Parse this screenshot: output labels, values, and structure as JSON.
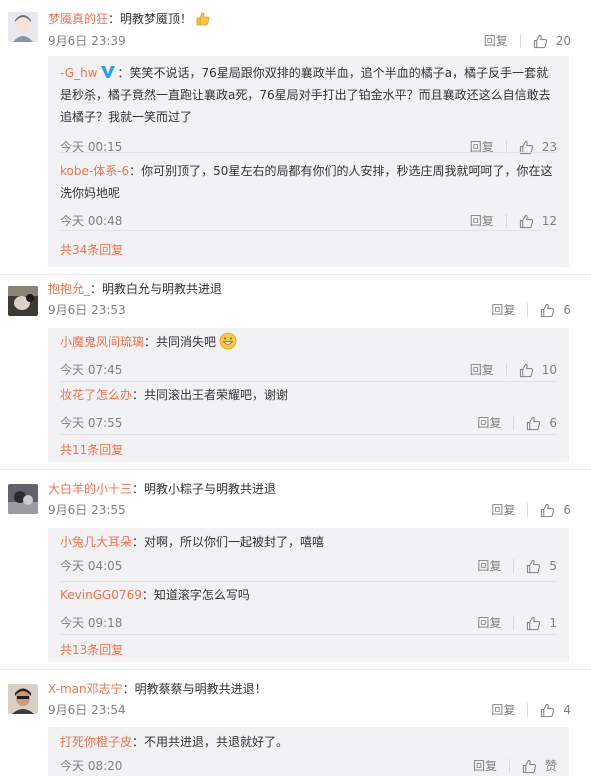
{
  "threads": [
    {
      "user": "梦魇真的狂",
      "text": "：明教梦魇顶！",
      "time": "9月6日 23:39",
      "reply": "回复",
      "likes": "20",
      "subs": [
        {
          "user": "-G_hw",
          "text": "：笑笑不说话，76星局跟你双排的襄政半血，追个半血的橘子a，橘子反手一套就是秒杀，橘子竟然一直跑让襄政a死，76星局对手打出了铂金水平？而且襄政还这么自信敢去追橘子？我就一笑而过了",
          "time": "今天 00:15",
          "reply": "回复",
          "likes": "23"
        },
        {
          "user": "kobe-体系-6",
          "text": "：你可别顶了，50星左右的局都有你们的人安排，秒选庄周我就呵呵了，你在这洗你妈地呢",
          "time": "今天 00:48",
          "reply": "回复",
          "likes": "12"
        }
      ],
      "more": "共34条回复"
    },
    {
      "user": "抱抱允_",
      "text": "：明教白允与明教共进退",
      "time": "9月6日 23:53",
      "reply": "回复",
      "likes": "6",
      "subs": [
        {
          "user": "小魔鬼风间琉璃",
          "text": "：共同消失吧",
          "time": "今天 07:45",
          "reply": "回复",
          "likes": "10"
        },
        {
          "user": "妆花了怎么办",
          "text": "：共同滚出王者荣耀吧，谢谢",
          "time": "今天 07:55",
          "reply": "回复",
          "likes": "6"
        }
      ],
      "more": "共11条回复"
    },
    {
      "user": "大白羊的小十三",
      "text": "：明教小粽子与明教共进退",
      "time": "9月6日 23:55",
      "reply": "回复",
      "likes": "6",
      "subs": [
        {
          "user": "小兔几大耳朵",
          "text": "：对啊，所以你们一起被封了，嘻嘻",
          "time": "今天 04:05",
          "reply": "回复",
          "likes": "5"
        },
        {
          "user": "KevinGG0769",
          "text": "：知道滚字怎么写吗",
          "time": "今天 09:18",
          "reply": "回复",
          "likes": "1"
        }
      ],
      "more": "共13条回复"
    },
    {
      "user": "X-man邓志宁",
      "text": "：明教蔡蔡与明教共进退！",
      "time": "9月6日 23:54",
      "reply": "回复",
      "likes": "4",
      "subs": [
        {
          "user": "打死你橙子皮",
          "text": "：不用共进退，共退就好了。",
          "time": "今天 08:20",
          "reply": "回复",
          "likes": "赞"
        }
      ],
      "more": ""
    }
  ],
  "colors": {
    "username": "#eb7350",
    "text": "#333333",
    "meta": "#808080",
    "subbox_bg": "#f2f2f5"
  }
}
